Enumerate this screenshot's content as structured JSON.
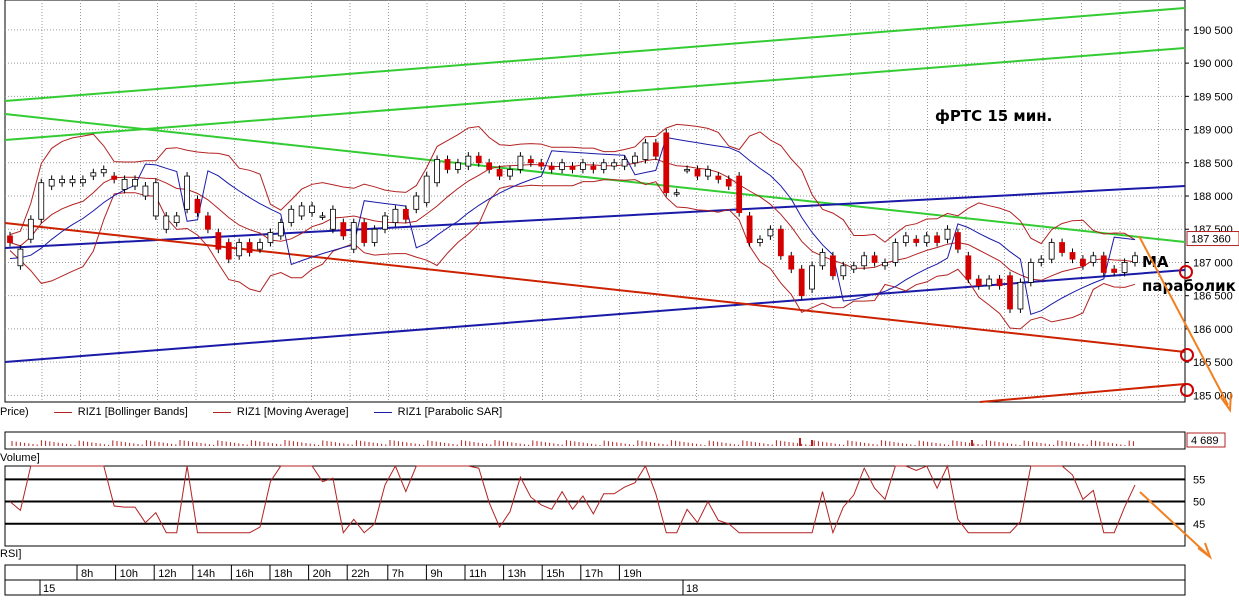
{
  "title": "фРТС   15 мин.",
  "annotations": {
    "ma": "MA",
    "sar": "параболик"
  },
  "legend": [
    {
      "label": "Price)",
      "color": "#000000"
    },
    {
      "label": "RIZ1 [Bollinger Bands]",
      "color": "#b22222"
    },
    {
      "label": "RIZ1 [Moving Average]",
      "color": "#b22222"
    },
    {
      "label": "RIZ1 [Parabolic SAR]",
      "color": "#1a1aa8"
    }
  ],
  "panels": {
    "volume": "Volume]",
    "rsi": "RSI]"
  },
  "colors": {
    "up": "#ffffff",
    "down": "#d40000",
    "green": "#33cc33",
    "blue": "#1a1aa8",
    "red": "#cc2200",
    "ma": "#b22222",
    "arrow": "#f08020"
  },
  "chart_data": {
    "type": "candlestick",
    "price_axis": {
      "ticks": [
        "190 500",
        "190 000",
        "189 500",
        "189 000",
        "188 500",
        "188 000",
        "187 500",
        "187 000",
        "186 500",
        "186 000",
        "185 500",
        "185 000"
      ],
      "ylim": [
        184900,
        190950
      ]
    },
    "last_price_label": "187 360",
    "volume_label": "4 689",
    "rsi_axis": {
      "ticks": [
        "55",
        "50",
        "45"
      ]
    },
    "time_labels": [
      "8h",
      "10h",
      "12h",
      "14h",
      "16h",
      "18h",
      "20h",
      "22h",
      "7h",
      "9h",
      "11h",
      "13h",
      "15h",
      "17h",
      "19h"
    ],
    "date_labels": [
      "15",
      "18"
    ],
    "candles_approx": [
      [
        187400,
        187300
      ],
      [
        186950,
        187200
      ],
      [
        187350,
        187650
      ],
      [
        187650,
        188200
      ],
      [
        188150,
        188250
      ],
      [
        188200,
        188250
      ],
      [
        188200,
        188250
      ],
      [
        188200,
        188250
      ],
      [
        188300,
        188350
      ],
      [
        188350,
        188400
      ],
      [
        188300,
        188250
      ],
      [
        188100,
        188250
      ],
      [
        188150,
        188250
      ],
      [
        188000,
        188150
      ],
      [
        187700,
        188200
      ],
      [
        187500,
        187700
      ],
      [
        187600,
        187700
      ],
      [
        187800,
        188300
      ],
      [
        187950,
        187750
      ],
      [
        187700,
        187500
      ],
      [
        187450,
        187200
      ],
      [
        187300,
        187050
      ],
      [
        187100,
        187300
      ],
      [
        187300,
        187150
      ],
      [
        187200,
        187300
      ],
      [
        187300,
        187450
      ],
      [
        187400,
        187600
      ],
      [
        187600,
        187800
      ],
      [
        187700,
        187850
      ],
      [
        187750,
        187850
      ],
      [
        187700,
        187700
      ],
      [
        187500,
        187800
      ],
      [
        187600,
        187400
      ],
      [
        187200,
        187600
      ],
      [
        187600,
        187300
      ],
      [
        187300,
        187500
      ],
      [
        187500,
        187700
      ],
      [
        187600,
        187800
      ],
      [
        187800,
        187650
      ],
      [
        187800,
        188000
      ],
      [
        187900,
        188300
      ],
      [
        188200,
        188550
      ],
      [
        188550,
        188400
      ],
      [
        188400,
        188500
      ],
      [
        188450,
        188600
      ],
      [
        188600,
        188500
      ],
      [
        188500,
        188400
      ],
      [
        188400,
        188300
      ],
      [
        188300,
        188400
      ],
      [
        188400,
        188600
      ],
      [
        188550,
        188500
      ],
      [
        188500,
        188450
      ],
      [
        188450,
        188400
      ],
      [
        188400,
        188500
      ],
      [
        188450,
        188400
      ],
      [
        188400,
        188500
      ],
      [
        188450,
        188400
      ],
      [
        188400,
        188500
      ],
      [
        188450,
        188500
      ],
      [
        188450,
        188550
      ],
      [
        188500,
        188600
      ],
      [
        188550,
        188800
      ],
      [
        188800,
        188600
      ],
      [
        188950,
        188050
      ],
      [
        188050,
        188050
      ],
      [
        188400,
        188400
      ],
      [
        188400,
        188300
      ],
      [
        188300,
        188400
      ],
      [
        188300,
        188250
      ],
      [
        188250,
        188150
      ],
      [
        188300,
        187750
      ],
      [
        187700,
        187300
      ],
      [
        187300,
        187350
      ],
      [
        187400,
        187500
      ],
      [
        187500,
        187100
      ],
      [
        187100,
        186900
      ],
      [
        186900,
        186500
      ],
      [
        186600,
        186950
      ],
      [
        186950,
        187150
      ],
      [
        187100,
        186800
      ],
      [
        186800,
        186950
      ],
      [
        186900,
        186950
      ],
      [
        186950,
        187100
      ],
      [
        187100,
        187000
      ],
      [
        186950,
        187000
      ],
      [
        187000,
        187300
      ],
      [
        187300,
        187400
      ],
      [
        187350,
        187300
      ],
      [
        187300,
        187400
      ],
      [
        187400,
        187300
      ],
      [
        187350,
        187500
      ],
      [
        187450,
        187200
      ],
      [
        187100,
        186750
      ],
      [
        186750,
        186650
      ],
      [
        186650,
        186750
      ],
      [
        186750,
        186650
      ],
      [
        186800,
        186300
      ],
      [
        186300,
        186700
      ],
      [
        186700,
        187000
      ],
      [
        187000,
        187050
      ],
      [
        187050,
        187300
      ],
      [
        187300,
        187150
      ],
      [
        187150,
        187050
      ],
      [
        187050,
        186950
      ],
      [
        187000,
        187100
      ],
      [
        187100,
        186850
      ],
      [
        186900,
        186850
      ],
      [
        186850,
        187000
      ],
      [
        187000,
        187100
      ]
    ]
  }
}
